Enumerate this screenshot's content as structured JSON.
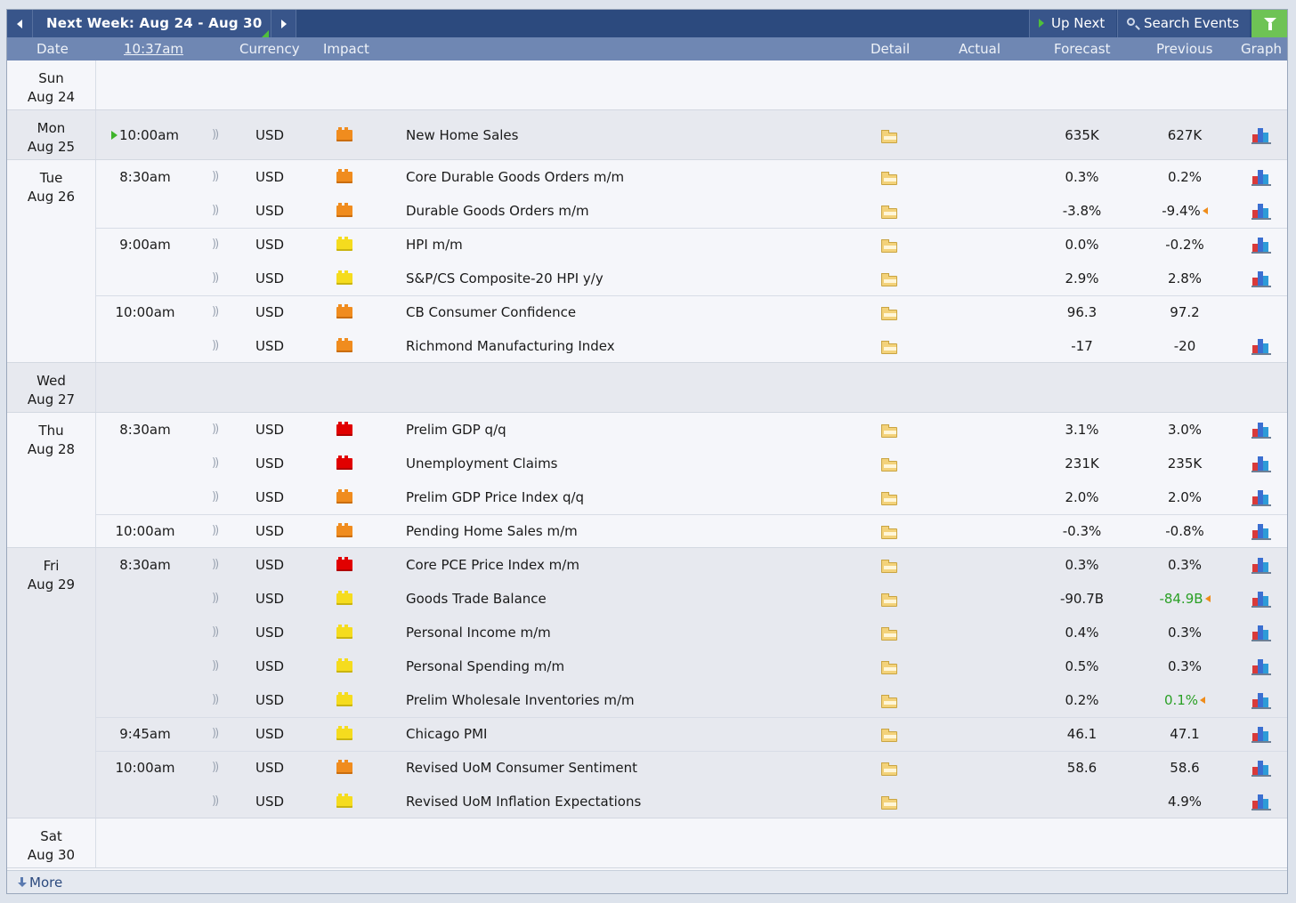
{
  "nav": {
    "week_title": "Next Week: Aug 24 - Aug 30",
    "up_next_label": "Up Next",
    "search_label": "Search Events",
    "accent": "#6ec355"
  },
  "header": {
    "date": "Date",
    "time": "10:37am",
    "currency": "Currency",
    "impact": "Impact",
    "detail": "Detail",
    "actual": "Actual",
    "forecast": "Forecast",
    "previous": "Previous",
    "graph": "Graph"
  },
  "impact_colors": {
    "high": "#e10000",
    "medium": "#f08c1e",
    "low": "#f5dc1e"
  },
  "days": [
    {
      "weekday": "Sun",
      "date": "Aug 24",
      "shade": "light",
      "groups": []
    },
    {
      "weekday": "Mon",
      "date": "Aug 25",
      "shade": "dark",
      "groups": [
        {
          "time": "10:00am",
          "current": true,
          "events": [
            {
              "currency": "USD",
              "impact": "medium",
              "name": "New Home Sales",
              "actual": "",
              "forecast": "635K",
              "previous": "627K",
              "previous_revision": "",
              "graph": true
            }
          ]
        }
      ]
    },
    {
      "weekday": "Tue",
      "date": "Aug 26",
      "shade": "light",
      "groups": [
        {
          "time": "8:30am",
          "events": [
            {
              "currency": "USD",
              "impact": "medium",
              "name": "Core Durable Goods Orders m/m",
              "actual": "",
              "forecast": "0.3%",
              "previous": "0.2%",
              "previous_revision": "",
              "graph": true
            },
            {
              "currency": "USD",
              "impact": "medium",
              "name": "Durable Goods Orders m/m",
              "actual": "",
              "forecast": "-3.8%",
              "previous": "-9.4%",
              "previous_revision": "down",
              "graph": true
            }
          ]
        },
        {
          "time": "9:00am",
          "events": [
            {
              "currency": "USD",
              "impact": "low",
              "name": "HPI m/m",
              "actual": "",
              "forecast": "0.0%",
              "previous": "-0.2%",
              "previous_revision": "",
              "graph": true
            },
            {
              "currency": "USD",
              "impact": "low",
              "name": "S&P/CS Composite-20 HPI y/y",
              "actual": "",
              "forecast": "2.9%",
              "previous": "2.8%",
              "previous_revision": "",
              "graph": true
            }
          ]
        },
        {
          "time": "10:00am",
          "events": [
            {
              "currency": "USD",
              "impact": "medium",
              "name": "CB Consumer Confidence",
              "actual": "",
              "forecast": "96.3",
              "previous": "97.2",
              "previous_revision": "",
              "graph": false
            },
            {
              "currency": "USD",
              "impact": "medium",
              "name": "Richmond Manufacturing Index",
              "actual": "",
              "forecast": "-17",
              "previous": "-20",
              "previous_revision": "",
              "graph": true
            }
          ]
        }
      ]
    },
    {
      "weekday": "Wed",
      "date": "Aug 27",
      "shade": "dark",
      "groups": []
    },
    {
      "weekday": "Thu",
      "date": "Aug 28",
      "shade": "light",
      "groups": [
        {
          "time": "8:30am",
          "events": [
            {
              "currency": "USD",
              "impact": "high",
              "name": "Prelim GDP q/q",
              "actual": "",
              "forecast": "3.1%",
              "previous": "3.0%",
              "previous_revision": "",
              "graph": true
            },
            {
              "currency": "USD",
              "impact": "high",
              "name": "Unemployment Claims",
              "actual": "",
              "forecast": "231K",
              "previous": "235K",
              "previous_revision": "",
              "graph": true
            },
            {
              "currency": "USD",
              "impact": "medium",
              "name": "Prelim GDP Price Index q/q",
              "actual": "",
              "forecast": "2.0%",
              "previous": "2.0%",
              "previous_revision": "",
              "graph": true
            }
          ]
        },
        {
          "time": "10:00am",
          "events": [
            {
              "currency": "USD",
              "impact": "medium",
              "name": "Pending Home Sales m/m",
              "actual": "",
              "forecast": "-0.3%",
              "previous": "-0.8%",
              "previous_revision": "",
              "graph": true
            }
          ]
        }
      ]
    },
    {
      "weekday": "Fri",
      "date": "Aug 29",
      "shade": "dark",
      "groups": [
        {
          "time": "8:30am",
          "events": [
            {
              "currency": "USD",
              "impact": "high",
              "name": "Core PCE Price Index m/m",
              "actual": "",
              "forecast": "0.3%",
              "previous": "0.3%",
              "previous_revision": "",
              "graph": true
            },
            {
              "currency": "USD",
              "impact": "low",
              "name": "Goods Trade Balance",
              "actual": "",
              "forecast": "-90.7B",
              "previous": "-84.9B",
              "previous_revision": "up",
              "graph": true
            },
            {
              "currency": "USD",
              "impact": "low",
              "name": "Personal Income m/m",
              "actual": "",
              "forecast": "0.4%",
              "previous": "0.3%",
              "previous_revision": "",
              "graph": true
            },
            {
              "currency": "USD",
              "impact": "low",
              "name": "Personal Spending m/m",
              "actual": "",
              "forecast": "0.5%",
              "previous": "0.3%",
              "previous_revision": "",
              "graph": true
            },
            {
              "currency": "USD",
              "impact": "low",
              "name": "Prelim Wholesale Inventories m/m",
              "actual": "",
              "forecast": "0.2%",
              "previous": "0.1%",
              "previous_revision": "up",
              "graph": true
            }
          ]
        },
        {
          "time": "9:45am",
          "events": [
            {
              "currency": "USD",
              "impact": "low",
              "name": "Chicago PMI",
              "actual": "",
              "forecast": "46.1",
              "previous": "47.1",
              "previous_revision": "",
              "graph": true
            }
          ]
        },
        {
          "time": "10:00am",
          "events": [
            {
              "currency": "USD",
              "impact": "medium",
              "name": "Revised UoM Consumer Sentiment",
              "actual": "",
              "forecast": "58.6",
              "previous": "58.6",
              "previous_revision": "",
              "graph": true
            },
            {
              "currency": "USD",
              "impact": "low",
              "name": "Revised UoM Inflation Expectations",
              "actual": "",
              "forecast": "",
              "previous": "4.9%",
              "previous_revision": "",
              "graph": true
            }
          ]
        }
      ]
    },
    {
      "weekday": "Sat",
      "date": "Aug 30",
      "shade": "light",
      "groups": []
    }
  ],
  "footer": {
    "more_label": "More"
  }
}
